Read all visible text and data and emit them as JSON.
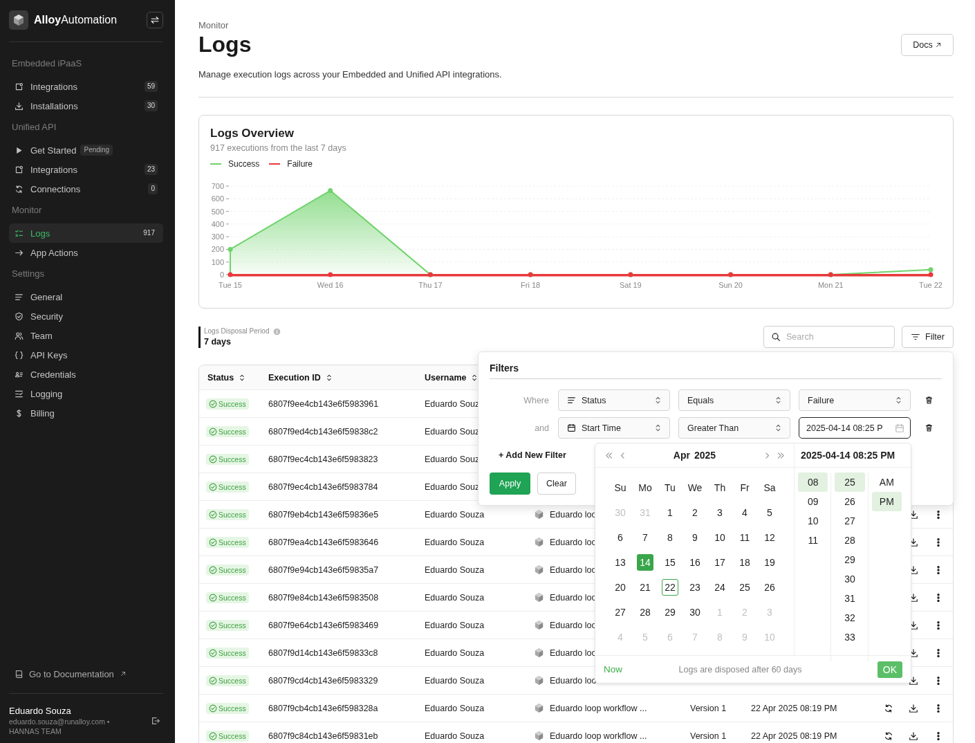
{
  "sidebar": {
    "brand": "**Alloy**Automation",
    "sections": [
      {
        "title": "Embedded iPaaS",
        "items": [
          {
            "label": "Integrations",
            "count": "59",
            "selected": false
          },
          {
            "label": "Installations",
            "count": "30",
            "selected": false
          }
        ]
      },
      {
        "title": "Unified API",
        "items": [
          {
            "label": "Get Started",
            "tag": "Pending",
            "selected": false
          },
          {
            "label": "Integrations",
            "count": "23",
            "selected": false
          },
          {
            "label": "Connections",
            "count": "0",
            "selected": false
          }
        ]
      },
      {
        "title": "Monitor",
        "items": [
          {
            "label": "Logs",
            "count": "917",
            "selected": true
          },
          {
            "label": "App Actions",
            "selected": false
          }
        ]
      },
      {
        "title": "Settings",
        "items": [
          {
            "label": "General",
            "selected": false
          },
          {
            "label": "Security",
            "selected": false
          },
          {
            "label": "Team",
            "selected": false
          },
          {
            "label": "API Keys",
            "selected": false
          },
          {
            "label": "Credentials",
            "selected": false
          },
          {
            "label": "Logging",
            "selected": false
          },
          {
            "label": "Billing",
            "selected": false
          }
        ]
      }
    ],
    "doc_link": "Go to Documentation",
    "user": {
      "name": "Eduardo Souza",
      "email": "eduardo.souza@runalloy.com •",
      "team": "HANNAS TEAM"
    }
  },
  "header": {
    "breadcrumb": "Monitor",
    "title": "Logs",
    "description": "Manage execution logs across your Embedded and Unified API integrations.",
    "docs_button": "Docs"
  },
  "overview": {
    "subtitle": "917 executions from the last 7 days",
    "chart_data": {
      "type": "area",
      "title": "Logs Overview",
      "categories": [
        "Tue 15",
        "Wed 16",
        "Thu 17",
        "Fri 18",
        "Sat 19",
        "Sun 20",
        "Mon 21",
        "Tue 22"
      ],
      "series": [
        {
          "name": "Success",
          "color": "#6fd36b",
          "marker": "circle",
          "values": [
            200,
            665,
            0,
            0,
            0,
            0,
            0,
            40
          ]
        },
        {
          "name": "Failure",
          "color": "#e8393c",
          "marker": "circle",
          "values": [
            0,
            0,
            0,
            0,
            0,
            0,
            0,
            0
          ]
        }
      ],
      "ylim": [
        0,
        700
      ],
      "grid": true,
      "yticks": [
        0,
        100,
        200,
        300,
        400,
        500,
        600,
        700
      ]
    }
  },
  "toolbar": {
    "disposal_label": "Logs Disposal Period",
    "disposal_value": "7 days",
    "search": {
      "placeholder": "Search"
    },
    "filter_button": "Filter"
  },
  "table": {
    "columns": [
      "Status",
      "Execution ID",
      "Username"
    ],
    "rows": [
      {
        "status": "Success",
        "execution_id": "6807f9ee4cb143e6f5983961",
        "username": "Eduardo Souz"
      },
      {
        "status": "Success",
        "execution_id": "6807f9ed4cb143e6f59838c2",
        "username": "Eduardo Souz"
      },
      {
        "status": "Success",
        "execution_id": "6807f9ec4cb143e6f5983823",
        "username": "Eduardo Souz"
      },
      {
        "status": "Success",
        "execution_id": "6807f9ec4cb143e6f5983784",
        "username": "Eduardo Souz"
      },
      {
        "status": "Success",
        "execution_id": "6807f9eb4cb143e6f59836e5",
        "username": "Eduardo Souza",
        "workflow": "Eduardo loo"
      },
      {
        "status": "Success",
        "execution_id": "6807f9ea4cb143e6f5983646",
        "username": "Eduardo Souza",
        "workflow": "Eduardo loo"
      },
      {
        "status": "Success",
        "execution_id": "6807f9e94cb143e6f59835a7",
        "username": "Eduardo Souza",
        "workflow": "Eduardo loo"
      },
      {
        "status": "Success",
        "execution_id": "6807f9e84cb143e6f5983508",
        "username": "Eduardo Souza",
        "workflow": "Eduardo loo"
      },
      {
        "status": "Success",
        "execution_id": "6807f9e64cb143e6f5983469",
        "username": "Eduardo Souza",
        "workflow": "Eduardo loo"
      },
      {
        "status": "Success",
        "execution_id": "6807f9d14cb143e6f59833c8",
        "username": "Eduardo Souza",
        "workflow": "Eduardo loo"
      },
      {
        "status": "Success",
        "execution_id": "6807f9cd4cb143e6f5983329",
        "username": "Eduardo Souza",
        "workflow": "Eduardo loo"
      },
      {
        "status": "Success",
        "execution_id": "6807f9cb4cb143e6f598328a",
        "username": "Eduardo Souza",
        "workflow": "Eduardo loop workflow ...",
        "version": "Version 1",
        "date": "22 Apr 2025 08:19 PM"
      },
      {
        "status": "Success",
        "execution_id": "6807f9c84cb143e6f59831eb",
        "username": "Eduardo Souza",
        "workflow": "Eduardo loop workflow ...",
        "version": "Version 1",
        "date": "22 Apr 2025 08:19 PM"
      }
    ]
  },
  "filters": {
    "title": "Filters",
    "rows": [
      {
        "conjunction": "Where",
        "field": "Status",
        "operator": "Equals",
        "value": "Failure",
        "kind": "select",
        "focused": false
      },
      {
        "conjunction": "and",
        "field": "Start Time",
        "operator": "Greater Than",
        "value": "2025-04-14 08:25 P",
        "kind": "date",
        "focused": true
      }
    ],
    "add_filter": "+ Add New Filter",
    "apply": "Apply",
    "clear": "Clear"
  },
  "date_picker": {
    "month": "Apr",
    "year": "2025",
    "selected_datetime": "2025-04-14 08:25 PM",
    "weekdays": [
      "Su",
      "Mo",
      "Tu",
      "We",
      "Th",
      "Fr",
      "Sa"
    ],
    "days": [
      {
        "label": "30",
        "kind": "other",
        "selected": false,
        "today": false
      },
      {
        "label": "31",
        "kind": "other",
        "selected": false,
        "today": false
      },
      {
        "label": "1",
        "kind": "current",
        "selected": false,
        "today": false
      },
      {
        "label": "2",
        "kind": "current",
        "selected": false,
        "today": false
      },
      {
        "label": "3",
        "kind": "current",
        "selected": false,
        "today": false
      },
      {
        "label": "4",
        "kind": "current",
        "selected": false,
        "today": false
      },
      {
        "label": "5",
        "kind": "current",
        "selected": false,
        "today": false
      },
      {
        "label": "6",
        "kind": "current",
        "selected": false,
        "today": false
      },
      {
        "label": "7",
        "kind": "current",
        "selected": false,
        "today": false
      },
      {
        "label": "8",
        "kind": "current",
        "selected": false,
        "today": false
      },
      {
        "label": "9",
        "kind": "current",
        "selected": false,
        "today": false
      },
      {
        "label": "10",
        "kind": "current",
        "selected": false,
        "today": false
      },
      {
        "label": "11",
        "kind": "current",
        "selected": false,
        "today": false
      },
      {
        "label": "12",
        "kind": "current",
        "selected": false,
        "today": false
      },
      {
        "label": "13",
        "kind": "current",
        "selected": false,
        "today": false
      },
      {
        "label": "14",
        "kind": "current",
        "selected": true,
        "today": false
      },
      {
        "label": "15",
        "kind": "current",
        "selected": false,
        "today": false
      },
      {
        "label": "16",
        "kind": "current",
        "selected": false,
        "today": false
      },
      {
        "label": "17",
        "kind": "current",
        "selected": false,
        "today": false
      },
      {
        "label": "18",
        "kind": "current",
        "selected": false,
        "today": false
      },
      {
        "label": "19",
        "kind": "current",
        "selected": false,
        "today": false
      },
      {
        "label": "20",
        "kind": "current",
        "selected": false,
        "today": false
      },
      {
        "label": "21",
        "kind": "current",
        "selected": false,
        "today": false
      },
      {
        "label": "22",
        "kind": "current",
        "selected": false,
        "today": true
      },
      {
        "label": "23",
        "kind": "current",
        "selected": false,
        "today": false
      },
      {
        "label": "24",
        "kind": "current",
        "selected": false,
        "today": false
      },
      {
        "label": "25",
        "kind": "current",
        "selected": false,
        "today": false
      },
      {
        "label": "26",
        "kind": "current",
        "selected": false,
        "today": false
      },
      {
        "label": "27",
        "kind": "current",
        "selected": false,
        "today": false
      },
      {
        "label": "28",
        "kind": "current",
        "selected": false,
        "today": false
      },
      {
        "label": "29",
        "kind": "current",
        "selected": false,
        "today": false
      },
      {
        "label": "30",
        "kind": "current",
        "selected": false,
        "today": false
      },
      {
        "label": "1",
        "kind": "other",
        "selected": false,
        "today": false
      },
      {
        "label": "2",
        "kind": "other",
        "selected": false,
        "today": false
      },
      {
        "label": "3",
        "kind": "other",
        "selected": false,
        "today": false
      },
      {
        "label": "4",
        "kind": "other",
        "selected": false,
        "today": false
      },
      {
        "label": "5",
        "kind": "other",
        "selected": false,
        "today": false
      },
      {
        "label": "6",
        "kind": "other",
        "selected": false,
        "today": false
      },
      {
        "label": "7",
        "kind": "other",
        "selected": false,
        "today": false
      },
      {
        "label": "8",
        "kind": "other",
        "selected": false,
        "today": false
      },
      {
        "label": "9",
        "kind": "other",
        "selected": false,
        "today": false
      },
      {
        "label": "10",
        "kind": "other",
        "selected": false,
        "today": false
      }
    ],
    "hours": [
      {
        "label": "08",
        "selected": true
      },
      {
        "label": "09",
        "selected": false
      },
      {
        "label": "10",
        "selected": false
      },
      {
        "label": "11",
        "selected": false
      }
    ],
    "minutes": [
      {
        "label": "25",
        "selected": true
      },
      {
        "label": "26",
        "selected": false
      },
      {
        "label": "27",
        "selected": false
      },
      {
        "label": "28",
        "selected": false
      },
      {
        "label": "29",
        "selected": false
      },
      {
        "label": "30",
        "selected": false
      },
      {
        "label": "31",
        "selected": false
      },
      {
        "label": "32",
        "selected": false
      },
      {
        "label": "33",
        "selected": false
      }
    ],
    "periods": [
      {
        "label": "AM",
        "selected": false
      },
      {
        "label": "PM",
        "selected": true
      }
    ],
    "now": "Now",
    "note": "Logs are disposed after 60 days",
    "ok": "OK"
  }
}
